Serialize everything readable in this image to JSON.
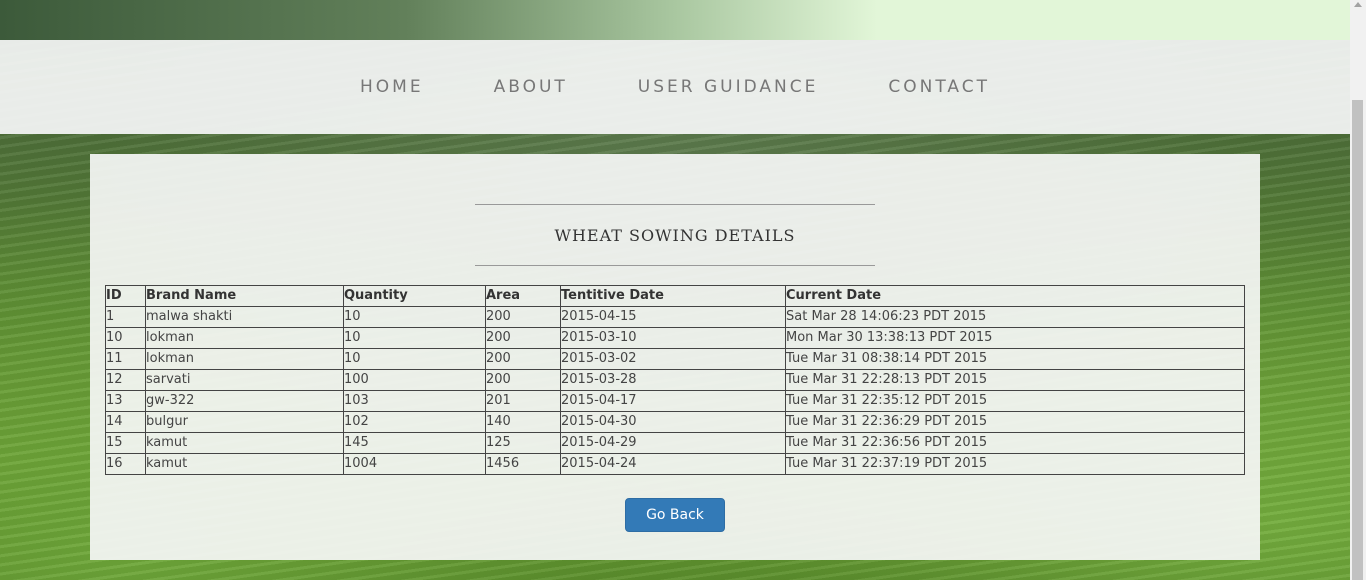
{
  "nav": {
    "items": [
      {
        "label": "HOME"
      },
      {
        "label": "ABOUT"
      },
      {
        "label": "USER GUIDANCE"
      },
      {
        "label": "CONTACT"
      }
    ]
  },
  "page": {
    "title": "WHEAT SOWING DETAILS"
  },
  "table": {
    "headers": [
      "ID",
      "Brand Name",
      "Quantity",
      "Area",
      "Tentitive Date",
      "Current Date"
    ],
    "rows": [
      [
        "1",
        "malwa shakti",
        "10",
        "200",
        "2015-04-15",
        "Sat Mar 28 14:06:23 PDT 2015"
      ],
      [
        "10",
        "lokman",
        "10",
        "200",
        "2015-03-10",
        "Mon Mar 30 13:38:13 PDT 2015"
      ],
      [
        "11",
        "lokman",
        "10",
        "200",
        "2015-03-02",
        "Tue Mar 31 08:38:14 PDT 2015"
      ],
      [
        "12",
        "sarvati",
        "100",
        "200",
        "2015-03-28",
        "Tue Mar 31 22:28:13 PDT 2015"
      ],
      [
        "13",
        "gw-322",
        "103",
        "201",
        "2015-04-17",
        "Tue Mar 31 22:35:12 PDT 2015"
      ],
      [
        "14",
        "bulgur",
        "102",
        "140",
        "2015-04-30",
        "Tue Mar 31 22:36:29 PDT 2015"
      ],
      [
        "15",
        "kamut",
        "145",
        "125",
        "2015-04-29",
        "Tue Mar 31 22:36:56 PDT 2015"
      ],
      [
        "16",
        "kamut",
        "1004",
        "1456",
        "2015-04-24",
        "Tue Mar 31 22:37:19 PDT 2015"
      ]
    ]
  },
  "actions": {
    "go_back_label": "Go Back"
  },
  "colors": {
    "button": "#337ab7",
    "nav_text": "#777777"
  }
}
